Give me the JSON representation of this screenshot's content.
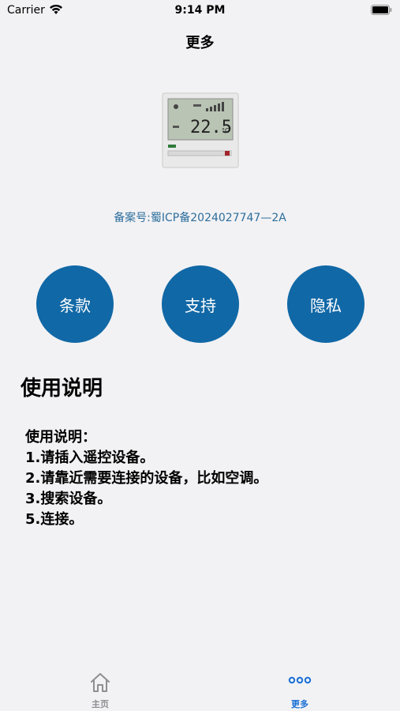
{
  "status_bar": {
    "carrier": "Carrier",
    "time": "9:14 PM"
  },
  "nav": {
    "title": "更多"
  },
  "product": {
    "image_icon": "thermostat-panel-icon",
    "display_temp": "22.5",
    "display_unit": "°C"
  },
  "icp": "备案号:蜀ICP备2024027747—2A",
  "buttons": [
    {
      "label": "条款"
    },
    {
      "label": "支持"
    },
    {
      "label": "隐私"
    }
  ],
  "section_title": "使用说明",
  "instructions": [
    "使用说明：",
    "1.请插入遥控设备。",
    "2.请靠近需要连接的设备，比如空调。",
    "3.搜索设备。",
    "5.连接。"
  ],
  "tabs": [
    {
      "label": "主页",
      "icon": "home-icon"
    },
    {
      "label": "更多",
      "icon": "more-icon"
    }
  ],
  "colors": {
    "accent": "#1168a6",
    "link": "#2d6e9c",
    "tab_active": "#1a6fd6",
    "tab_inactive": "#8e8e93"
  }
}
